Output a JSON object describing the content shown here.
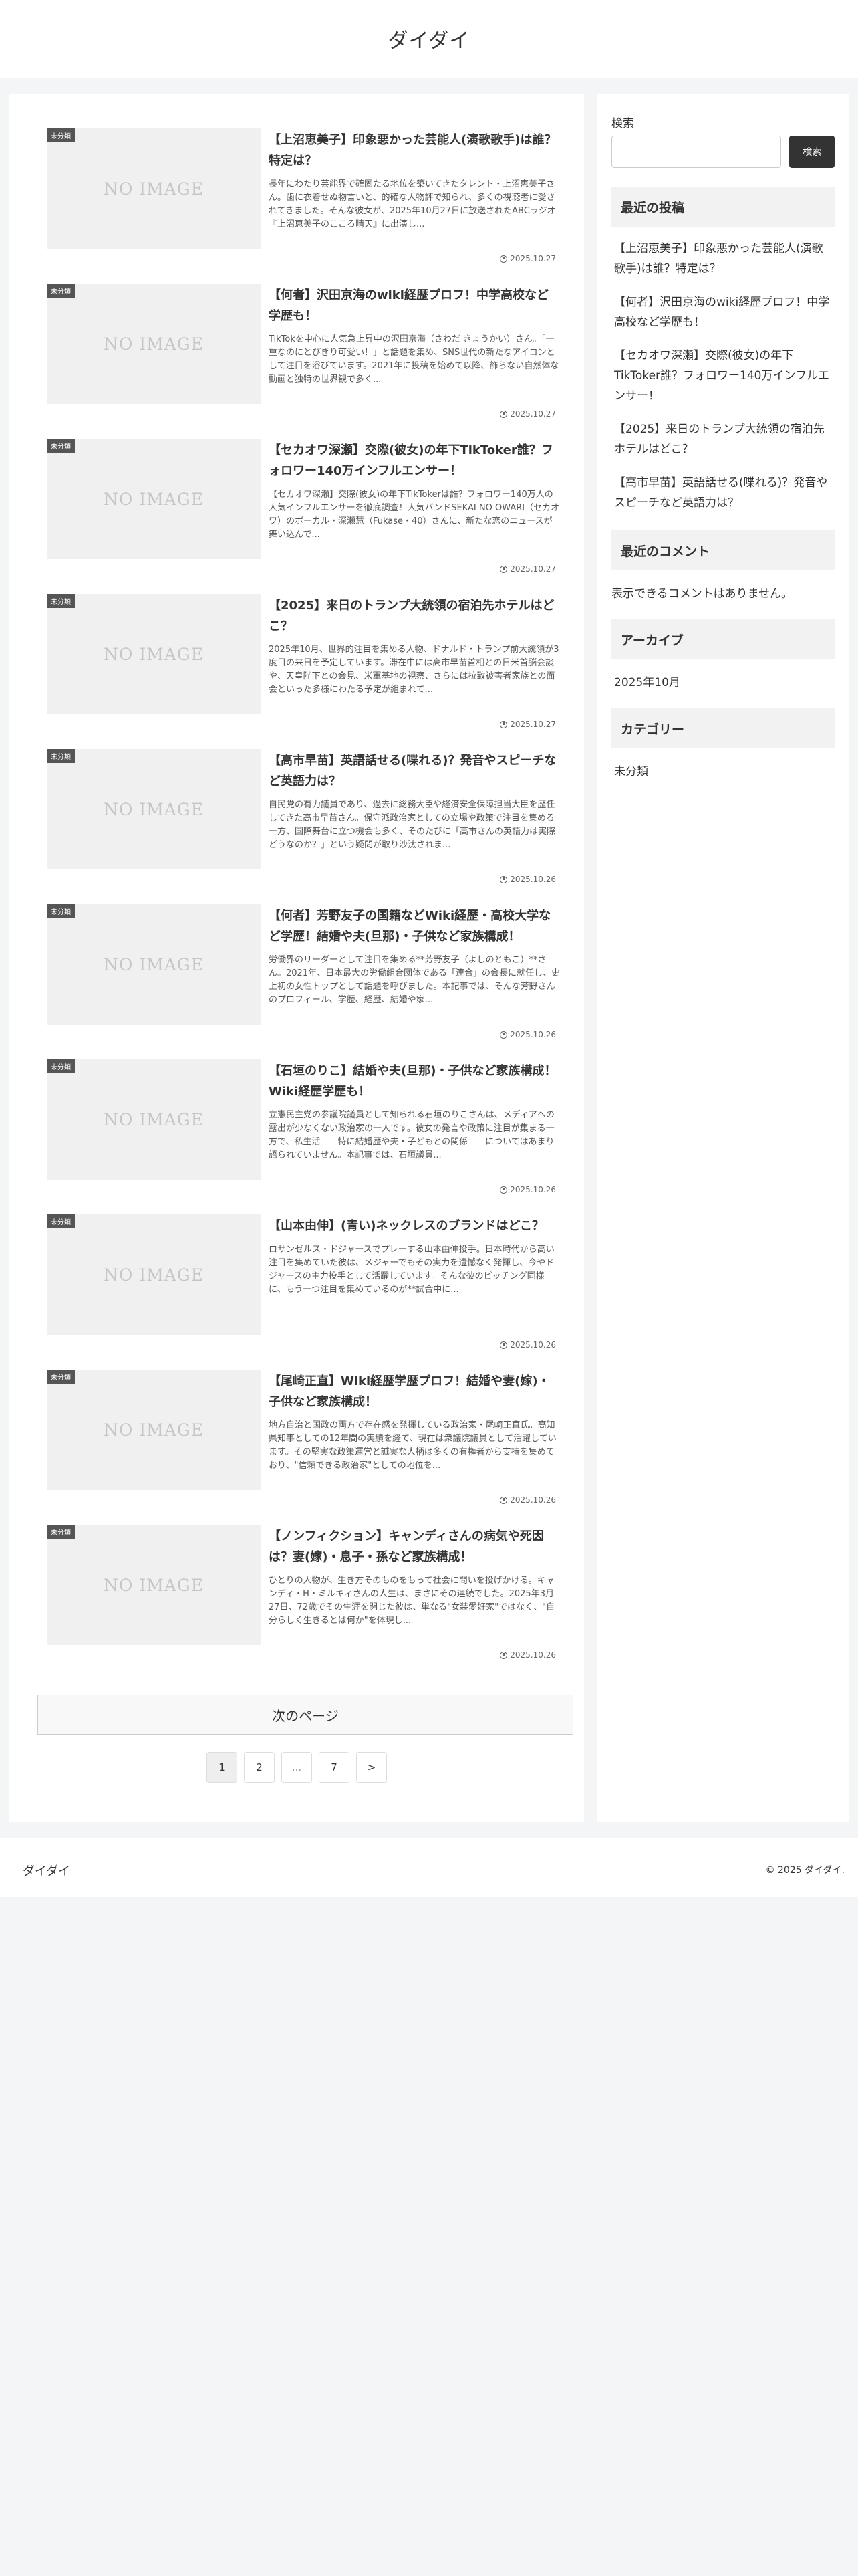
{
  "site": {
    "title": "ダイダイ"
  },
  "articles": [
    {
      "category": "未分類",
      "thumb": "NO IMAGE",
      "title": "【上沼恵美子】印象悪かった芸能人(演歌歌手)は誰？特定は？",
      "excerpt": "長年にわたり芸能界で確固たる地位を築いてきたタレント・上沼恵美子さん。歯に衣着せぬ物言いと、的確な人物評で知られ、多くの視聴者に愛されてきました。そんな彼女が、2025年10月27日に放送されたABCラジオ『上沼恵美子のこころ晴天』に出演し...",
      "date": "2025.10.27"
    },
    {
      "category": "未分類",
      "thumb": "NO IMAGE",
      "title": "【何者】沢田京海のwiki経歴プロフ！中学高校など学歴も！",
      "excerpt": "TikTokを中心に人気急上昇中の沢田京海（さわだ きょうかい）さん。「一重なのにとびきり可愛い！」と話題を集め、SNS世代の新たなアイコンとして注目を浴びています。2021年に投稿を始めて以降、飾らない自然体な動画と独特の世界観で多く...",
      "date": "2025.10.27"
    },
    {
      "category": "未分類",
      "thumb": "NO IMAGE",
      "title": "【セカオワ深瀬】交際(彼女)の年下TikToker誰？フォロワー140万インフルエンサー！",
      "excerpt": "【セカオワ深瀬】交際(彼女)の年下TikTokerは誰？フォロワー140万人の人気インフルエンサーを徹底調査！人気バンドSEKAI NO OWARI（セカオワ）のボーカル・深瀬慧（Fukase・40）さんに、新たな恋のニュースが舞い込んで...",
      "date": "2025.10.27"
    },
    {
      "category": "未分類",
      "thumb": "NO IMAGE",
      "title": "【2025】来日のトランプ大統領の宿泊先ホテルはどこ？",
      "excerpt": "2025年10月、世界的注目を集める人物、ドナルド・トランプ前大統領が3度目の来日を予定しています。滞在中には高市早苗首相との日米首脳会談や、天皇陛下との会見、米軍基地の視察、さらには拉致被害者家族との面会といった多様にわたる予定が組まれて...",
      "date": "2025.10.27"
    },
    {
      "category": "未分類",
      "thumb": "NO IMAGE",
      "title": "【高市早苗】英語話せる(喋れる)？発音やスピーチなど英語力は？",
      "excerpt": "自民党の有力議員であり、過去に総務大臣や経済安全保障担当大臣を歴任してきた高市早苗さん。保守派政治家としての立場や政策で注目を集める一方、国際舞台に立つ機会も多く、そのたびに「高市さんの英語力は実際どうなのか？」という疑問が取り沙汰されま...",
      "date": "2025.10.26"
    },
    {
      "category": "未分類",
      "thumb": "NO IMAGE",
      "title": "【何者】芳野友子の国籍などWiki経歴・高校大学など学歴！結婚や夫(旦那)・子供など家族構成！",
      "excerpt": "労働界のリーダーとして注目を集める**芳野友子（よしのともこ）**さん。2021年、日本最大の労働組合団体である「連合」の会長に就任し、史上初の女性トップとして話題を呼びました。本記事では、そんな芳野さんのプロフィール、学歴、経歴、結婚や家...",
      "date": "2025.10.26"
    },
    {
      "category": "未分類",
      "thumb": "NO IMAGE",
      "title": "【石垣のりこ】結婚や夫(旦那)・子供など家族構成！Wiki経歴学歴も！",
      "excerpt": "立憲民主党の参議院議員として知られる石垣のりこさんは、メディアへの露出が少なくない政治家の一人です。彼女の発言や政策に注目が集まる一方で、私生活——特に結婚歴や夫・子どもとの関係——についてはあまり語られていません。本記事では、石垣議員...",
      "date": "2025.10.26"
    },
    {
      "category": "未分類",
      "thumb": "NO IMAGE",
      "title": "【山本由伸】(青い)ネックレスのブランドはどこ？",
      "excerpt": "ロサンゼルス・ドジャースでプレーする山本由伸投手。日本時代から高い注目を集めていた彼は、メジャーでもその実力を遺憾なく発揮し、今やドジャースの主力投手として活躍しています。そんな彼のピッチング同様に、もう一つ注目を集めているのが**試合中に...",
      "date": "2025.10.26"
    },
    {
      "category": "未分類",
      "thumb": "NO IMAGE",
      "title": "【尾崎正直】Wiki経歴学歴プロフ！結婚や妻(嫁)・子供など家族構成！",
      "excerpt": "地方自治と国政の両方で存在感を発揮している政治家・尾崎正直氏。高知県知事としての12年間の実績を経て、現在は衆議院議員として活躍しています。その堅実な政策運営と誠実な人柄は多くの有権者から支持を集めており、\"信頼できる政治家\"としての地位を...",
      "date": "2025.10.26"
    },
    {
      "category": "未分類",
      "thumb": "NO IMAGE",
      "title": "【ノンフィクション】キャンディさんの病気や死因は？妻(嫁)・息子・孫など家族構成！",
      "excerpt": "ひとりの人物が、生き方そのものをもって社会に問いを投げかける。キャンディ・H・ミルキィさんの人生は、まさにその連続でした。2025年3月27日、72歳でその生涯を閉じた彼は、単なる\"女装愛好家\"ではなく、\"自分らしく生きるとは何か\"を体現し...",
      "date": "2025.10.26"
    }
  ],
  "pagination": {
    "next_label": "次のページ",
    "pages": [
      "1",
      "2",
      "...",
      "7",
      ">"
    ]
  },
  "sidebar": {
    "search_label": "検索",
    "search_value": "",
    "search_button": "検索",
    "recent_posts_title": "最近の投稿",
    "recent_posts": [
      "【上沼恵美子】印象悪かった芸能人(演歌歌手)は誰？特定は？",
      "【何者】沢田京海のwiki経歴プロフ！中学高校など学歴も！",
      "【セカオワ深瀬】交際(彼女)の年下TikToker誰？フォロワー140万インフルエンサー！",
      "【2025】来日のトランプ大統領の宿泊先ホテルはどこ？",
      "【高市早苗】英語話せる(喋れる)？発音やスピーチなど英語力は？"
    ],
    "recent_comments_title": "最近のコメント",
    "recent_comments_empty": "表示できるコメントはありません。",
    "archives_title": "アーカイブ",
    "archives": [
      "2025年10月"
    ],
    "categories_title": "カテゴリー",
    "categories": [
      "未分類"
    ]
  },
  "footer": {
    "logo": "ダイダイ",
    "copyright": "© 2025 ダイダイ."
  }
}
